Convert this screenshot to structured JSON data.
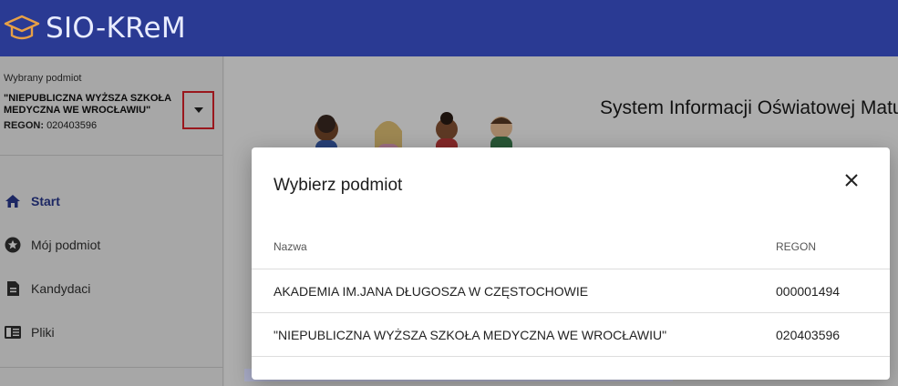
{
  "app": {
    "title": "SIO-KReM"
  },
  "sidebar": {
    "subject_caption": "Wybrany podmiot",
    "subject_name": "\"NIEPUBLICZNA WYŻSZA SZKOŁA MEDYCZNA WE WROCŁAWIU\"",
    "regon_label": "REGON:",
    "regon_value": "020403596",
    "nav": [
      {
        "label": "Start",
        "icon": "home-icon",
        "active": true
      },
      {
        "label": "Mój podmiot",
        "icon": "star-circle-icon",
        "active": false
      },
      {
        "label": "Kandydaci",
        "icon": "document-icon",
        "active": false
      },
      {
        "label": "Pliki",
        "icon": "file-book-icon",
        "active": false
      }
    ]
  },
  "main": {
    "hero_title": "System Informacji Oświatowej Matur"
  },
  "modal": {
    "title": "Wybierz podmiot",
    "columns": {
      "name": "Nazwa",
      "regon": "REGON"
    },
    "rows": [
      {
        "name": "AKADEMIA IM.JANA DŁUGOSZA W CZĘSTOCHOWIE",
        "regon": "000001494"
      },
      {
        "name": "\"NIEPUBLICZNA WYŻSZA SZKOŁA MEDYCZNA WE WROCŁAWIU\"",
        "regon": "020403596"
      }
    ]
  },
  "colors": {
    "brand": "#2a3a93",
    "highlight": "#e3232b",
    "logo_accent": "#e8a045"
  }
}
